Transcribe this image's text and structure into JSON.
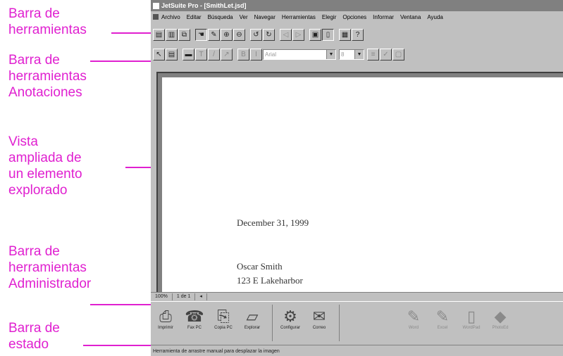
{
  "annotations": {
    "toolbar": "Barra de\nherramientas",
    "annotation_toolbar": "Barra de\nherramientas\nAnotaciones",
    "zoomed_view": "Vista\nampliada de\nun elemento\nexplorado",
    "manager_bar": "Barra de\nherramientas\nAdministrador",
    "status_bar": "Barra de\nestado"
  },
  "colors": {
    "annotation": "#e020d0",
    "window_chrome": "#c0c0c0"
  },
  "window": {
    "title": "JetSuite Pro - [SmithLet.jsd]",
    "menu": [
      "Archivo",
      "Editar",
      "Búsqueda",
      "Ver",
      "Navegar",
      "Herramientas",
      "Elegir",
      "Opciones",
      "Informar",
      "Ventana",
      "Ayuda"
    ]
  },
  "toolbar_icons": [
    "scan-icon",
    "print-icon",
    "copy-icon",
    "hand-icon",
    "pencil-icon",
    "zoom-in-icon",
    "zoom-out-icon",
    "rotate-icon",
    "page-icon",
    "stamp-icon"
  ],
  "annotation_toolbar": {
    "font_combo": "Arial",
    "size_combo": "8"
  },
  "document": {
    "date": "December 31, 1999",
    "recipient_name": "Oscar Smith",
    "recipient_street": "123 E Lakeharbor"
  },
  "zoom_bar": {
    "zoom": "100%",
    "page": "1 de 1"
  },
  "manager_bar": {
    "buttons": [
      {
        "label": "Imprimir",
        "icon": "printer-icon"
      },
      {
        "label": "Fax PC",
        "icon": "fax-icon"
      },
      {
        "label": "Copia PC",
        "icon": "copy-pc-icon"
      },
      {
        "label": "Explorar",
        "icon": "scanner-icon"
      },
      {
        "label": "Configurar",
        "icon": "configure-icon"
      },
      {
        "label": "Correo",
        "icon": "mail-icon"
      }
    ],
    "app_buttons": [
      {
        "label": "Word",
        "icon": "word-icon"
      },
      {
        "label": "Excel",
        "icon": "excel-icon"
      },
      {
        "label": "WordPad",
        "icon": "wordpad-icon"
      },
      {
        "label": "PhotoEd",
        "icon": "photoed-icon"
      }
    ]
  },
  "status_bar": {
    "text": "Herramienta de arrastre manual para desplazar la imagen"
  }
}
